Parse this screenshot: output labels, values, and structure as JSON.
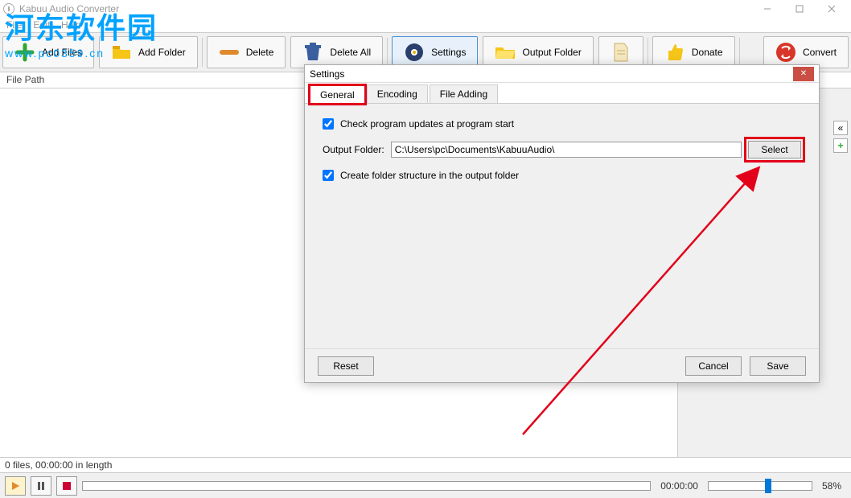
{
  "app": {
    "title": "Kabuu Audio Converter"
  },
  "menu": {
    "file": "File",
    "edit": "Edit",
    "help": "Help"
  },
  "toolbar": {
    "addfiles": "Add Files",
    "addfolder": "Add Folder",
    "delete": "Delete",
    "deleteall": "Delete All",
    "settings": "Settings",
    "outputfolder": "Output Folder",
    "donate": "Donate",
    "convert": "Convert"
  },
  "list": {
    "header_filepath": "File Path"
  },
  "status": {
    "summary": "0 files, 00:00:00 in length"
  },
  "player": {
    "time": "00:00:00",
    "volume": "58%"
  },
  "dialog": {
    "title": "Settings",
    "tabs": {
      "general": "General",
      "encoding": "Encoding",
      "fileadding": "File Adding"
    },
    "check_updates_label": "Check program updates at program start",
    "check_updates_checked": true,
    "output_folder_label": "Output Folder:",
    "output_folder_value": "C:\\Users\\pc\\Documents\\KabuuAudio\\",
    "select_label": "Select",
    "create_structure_label": "Create folder structure in the output folder",
    "create_structure_checked": true,
    "reset": "Reset",
    "cancel": "Cancel",
    "save": "Save"
  },
  "watermark": {
    "big": "河东软件园",
    "small": "www.pc0359.cn"
  },
  "strip": {
    "chevrons": "«",
    "plus": "+"
  }
}
